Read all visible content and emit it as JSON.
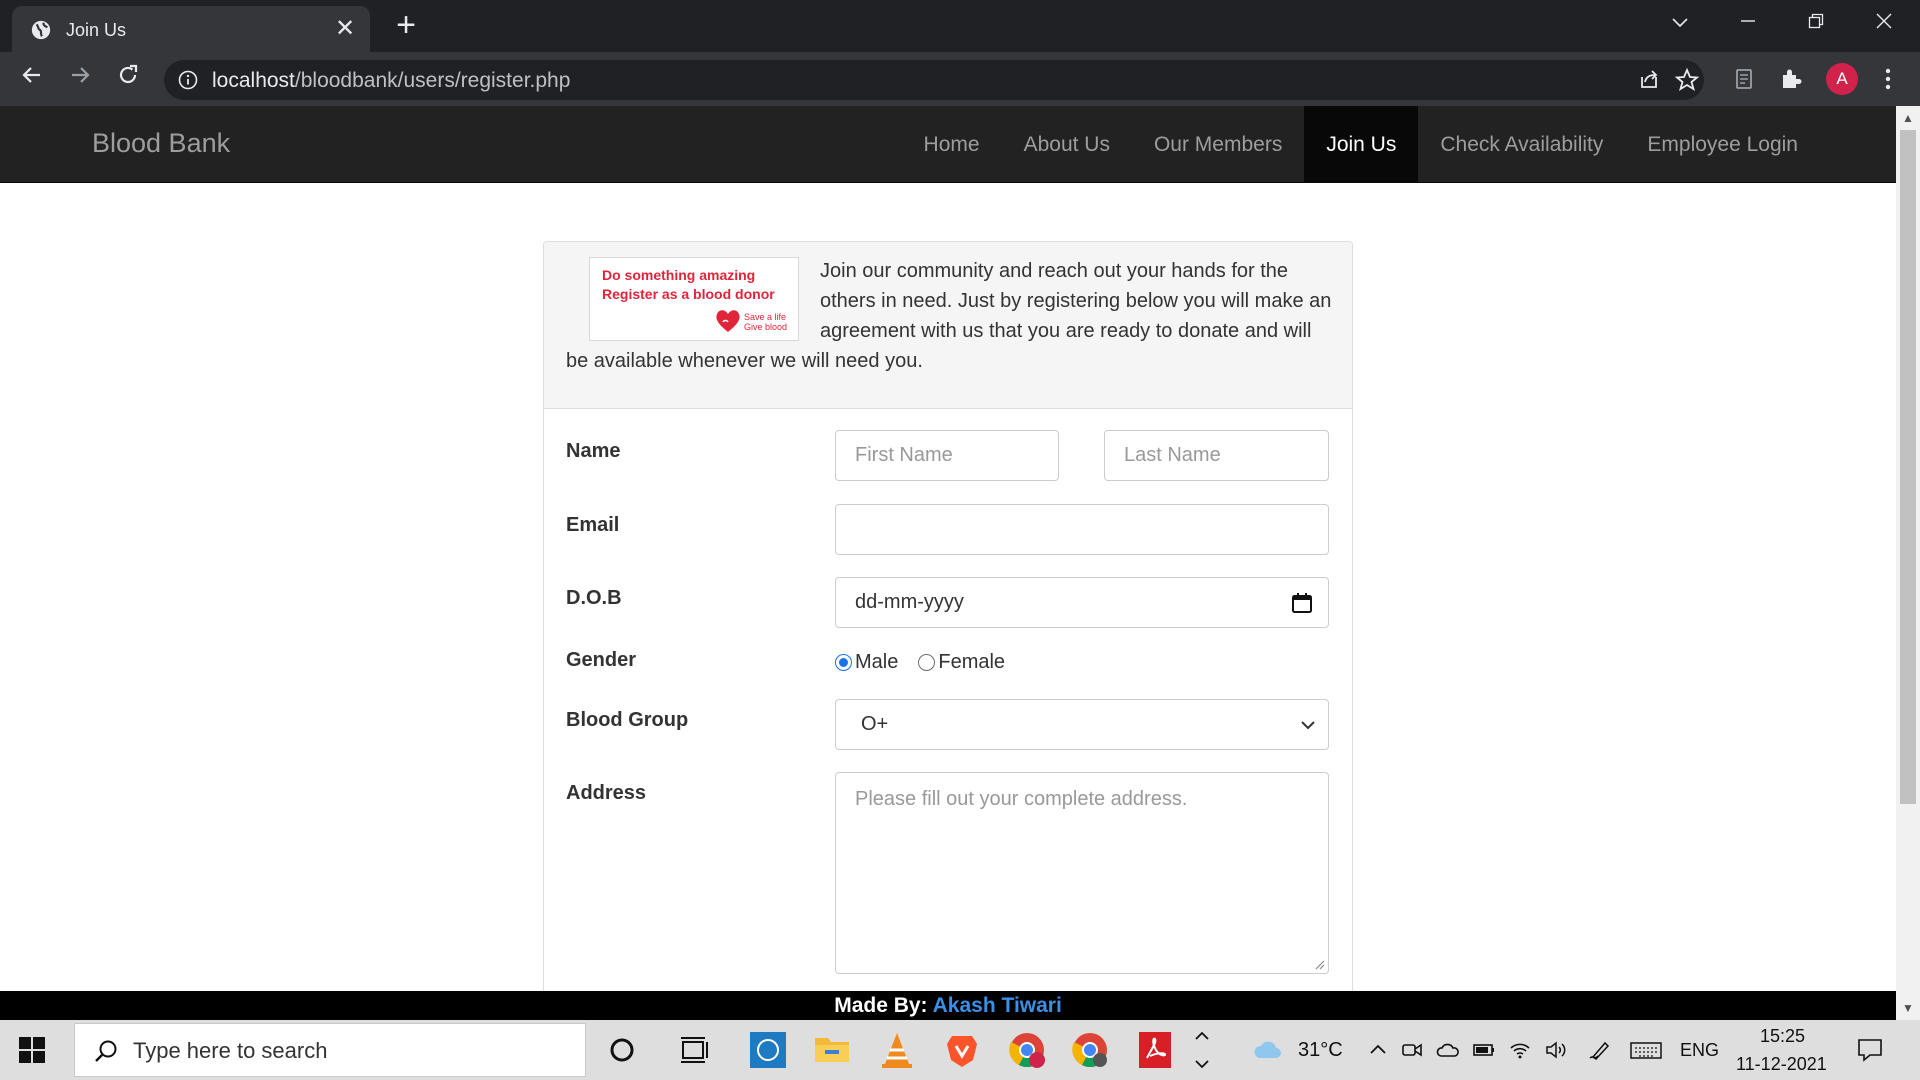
{
  "browser": {
    "tab_title": "Join Us",
    "url_host": "localhost",
    "url_path": "/bloodbank/users/register.php",
    "profile_initial": "A"
  },
  "site": {
    "brand": "Blood Bank",
    "nav": {
      "home": "Home",
      "about": "About Us",
      "members": "Our Members",
      "join": "Join Us",
      "check": "Check Availability",
      "employee": "Employee Login"
    },
    "accent_color": "#e0253a"
  },
  "promo": {
    "line1": "Do something amazing",
    "line2": "Register as a blood donor",
    "tag1": "Save a life",
    "tag2": "Give blood"
  },
  "intro_text": "Join our community and reach out your hands for the others in need. Just by registering below you will make an agreement with us that you are ready to donate and will be available whenever we will need you.",
  "form": {
    "name_label": "Name",
    "first_name_placeholder": "First Name",
    "last_name_placeholder": "Last Name",
    "email_label": "Email",
    "email_value": "",
    "dob_label": "D.O.B",
    "dob_placeholder": "dd-mm-yyyy",
    "gender_label": "Gender",
    "gender_male": "Male",
    "gender_female": "Female",
    "gender_selected": "Male",
    "blood_group_label": "Blood Group",
    "blood_group_value": "O+",
    "address_label": "Address",
    "address_placeholder": "Please fill out your complete address."
  },
  "footer": {
    "prefix": "Made By:",
    "author": "Akash Tiwari"
  },
  "taskbar": {
    "search_placeholder": "Type here to search",
    "weather": "31°C",
    "language": "ENG",
    "time": "15:25",
    "date": "11-12-2021"
  }
}
